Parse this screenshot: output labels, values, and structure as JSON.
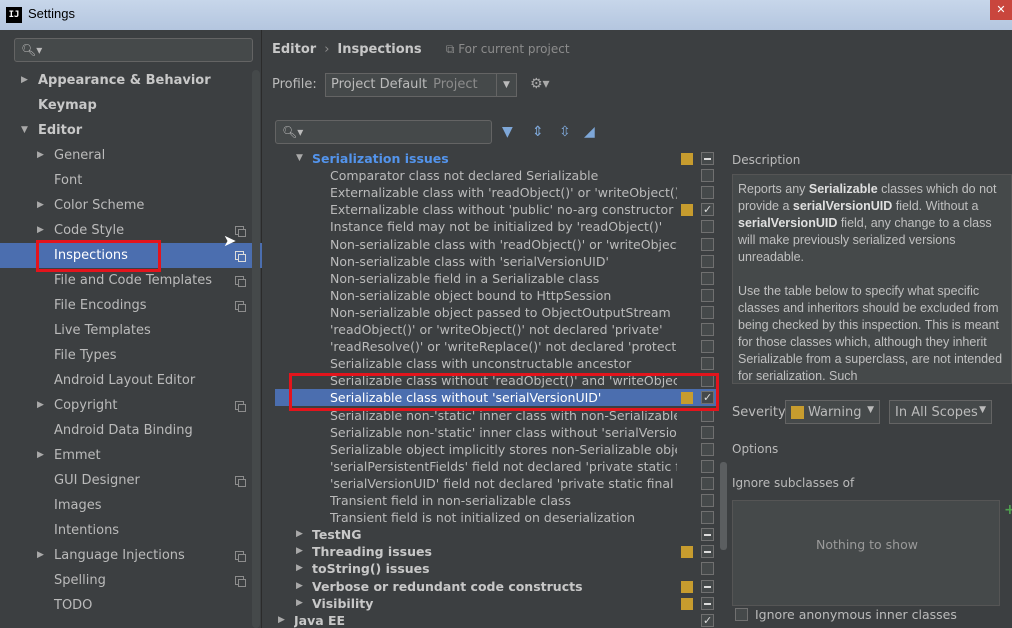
{
  "window": {
    "title": "Settings",
    "app_icon": "IJ"
  },
  "sidebar": {
    "search_placeholder": "",
    "items": [
      {
        "label": "Appearance & Behavior",
        "level": 0,
        "expandable": true,
        "expanded": false,
        "bold": true
      },
      {
        "label": "Keymap",
        "level": 0,
        "expandable": false,
        "bold": true
      },
      {
        "label": "Editor",
        "level": 0,
        "expandable": true,
        "expanded": true,
        "bold": true
      },
      {
        "label": "General",
        "level": 1,
        "expandable": true
      },
      {
        "label": "Font",
        "level": 1,
        "expandable": false
      },
      {
        "label": "Color Scheme",
        "level": 1,
        "expandable": true
      },
      {
        "label": "Code Style",
        "level": 1,
        "expandable": true,
        "project": true
      },
      {
        "label": "Inspections",
        "level": 1,
        "expandable": false,
        "project": true,
        "selected": true
      },
      {
        "label": "File and Code Templates",
        "level": 1,
        "expandable": false,
        "project": true
      },
      {
        "label": "File Encodings",
        "level": 1,
        "expandable": false,
        "project": true
      },
      {
        "label": "Live Templates",
        "level": 1,
        "expandable": false
      },
      {
        "label": "File Types",
        "level": 1,
        "expandable": false
      },
      {
        "label": "Android Layout Editor",
        "level": 1,
        "expandable": false
      },
      {
        "label": "Copyright",
        "level": 1,
        "expandable": true,
        "project": true
      },
      {
        "label": "Android Data Binding",
        "level": 1,
        "expandable": false
      },
      {
        "label": "Emmet",
        "level": 1,
        "expandable": true
      },
      {
        "label": "GUI Designer",
        "level": 1,
        "expandable": false,
        "project": true
      },
      {
        "label": "Images",
        "level": 1,
        "expandable": false
      },
      {
        "label": "Intentions",
        "level": 1,
        "expandable": false
      },
      {
        "label": "Language Injections",
        "level": 1,
        "expandable": true,
        "project": true
      },
      {
        "label": "Spelling",
        "level": 1,
        "expandable": false,
        "project": true
      },
      {
        "label": "TODO",
        "level": 1,
        "expandable": false
      }
    ]
  },
  "breadcrumb": {
    "parent": "Editor",
    "current": "Inspections",
    "scope_note": "For current project"
  },
  "profile": {
    "label": "Profile:",
    "value": "Project Default",
    "value_sub": "Project"
  },
  "inspections": [
    {
      "label": "Serialization issues",
      "type": "groupopen",
      "level": 1,
      "severity": true,
      "check": "partial"
    },
    {
      "label": "Comparator class not declared Serializable",
      "level": 2,
      "check": "none"
    },
    {
      "label": "Externalizable class with 'readObject()' or 'writeObject()'",
      "level": 2,
      "check": "none"
    },
    {
      "label": "Externalizable class without 'public' no-arg constructor",
      "level": 2,
      "severity": true,
      "check": "checked"
    },
    {
      "label": "Instance field may not be initialized by 'readObject()'",
      "level": 2,
      "check": "none"
    },
    {
      "label": "Non-serializable class with 'readObject()' or 'writeObject()'",
      "level": 2,
      "check": "none"
    },
    {
      "label": "Non-serializable class with 'serialVersionUID'",
      "level": 2,
      "check": "none"
    },
    {
      "label": "Non-serializable field in a Serializable class",
      "level": 2,
      "check": "none"
    },
    {
      "label": "Non-serializable object bound to HttpSession",
      "level": 2,
      "check": "none"
    },
    {
      "label": "Non-serializable object passed to ObjectOutputStream",
      "level": 2,
      "check": "none"
    },
    {
      "label": "'readObject()' or 'writeObject()' not declared 'private'",
      "level": 2,
      "check": "none"
    },
    {
      "label": "'readResolve()' or 'writeReplace()' not declared 'protected'",
      "level": 2,
      "check": "none"
    },
    {
      "label": "Serializable class with unconstructable ancestor",
      "level": 2,
      "check": "none"
    },
    {
      "label": "Serializable class without 'readObject()' and 'writeObject()'",
      "level": 2,
      "check": "none"
    },
    {
      "label": "Serializable class without 'serialVersionUID'",
      "level": 2,
      "severity": true,
      "check": "checked",
      "selected": true
    },
    {
      "label": "Serializable non-'static' inner class with non-Serializable outer class",
      "level": 2,
      "check": "none"
    },
    {
      "label": "Serializable non-'static' inner class without 'serialVersionUID'",
      "level": 2,
      "check": "none"
    },
    {
      "label": "Serializable object implicitly stores non-Serializable object",
      "level": 2,
      "check": "none"
    },
    {
      "label": "'serialPersistentFields' field not declared 'private static final ObjectStreamField[]'",
      "level": 2,
      "check": "none"
    },
    {
      "label": "'serialVersionUID' field not declared 'private static final long'",
      "level": 2,
      "check": "none"
    },
    {
      "label": "Transient field in non-serializable class",
      "level": 2,
      "check": "none"
    },
    {
      "label": "Transient field is not initialized on deserialization",
      "level": 2,
      "check": "none"
    },
    {
      "label": "TestNG",
      "type": "group",
      "level": 1,
      "check": "partial"
    },
    {
      "label": "Threading issues",
      "type": "group",
      "level": 1,
      "severity": true,
      "check": "partial"
    },
    {
      "label": "toString() issues",
      "type": "group",
      "level": 1,
      "check": "none"
    },
    {
      "label": "Verbose or redundant code constructs",
      "type": "group",
      "level": 1,
      "severity": true,
      "check": "partial"
    },
    {
      "label": "Visibility",
      "type": "group",
      "level": 1,
      "severity": true,
      "check": "partial"
    },
    {
      "label": "Java EE",
      "type": "group",
      "level": 0,
      "check": "checked"
    }
  ],
  "description": {
    "title": "Description",
    "p1_a": "Reports any ",
    "p1_b": "Serializable",
    "p1_c": " classes which do not provide a ",
    "p1_d": "serialVersionUID",
    "p1_e": " field. Without a ",
    "p1_f": "serialVersionUID",
    "p1_g": " field, any change to a class will make previously serialized versions unreadable.",
    "p2": "Use the table below to specify what specific classes and inheritors should be excluded from being checked by this inspection. This is meant for those classes which, although they inherit Serializable from a superclass, are not intended for serialization. Such"
  },
  "severity": {
    "label": "Severity:",
    "value": "Warning",
    "scope": "In All Scopes",
    "color": "#c79c2e"
  },
  "options": {
    "title": "Options",
    "ignore_subclasses_label": "Ignore subclasses of",
    "empty_text": "Nothing to show",
    "ignore_anonymous_label": "Ignore anonymous inner classes"
  },
  "colors": {
    "accent": "#4b6eaf",
    "highlight_box": "#e3141c",
    "group_link": "#5394ec"
  }
}
